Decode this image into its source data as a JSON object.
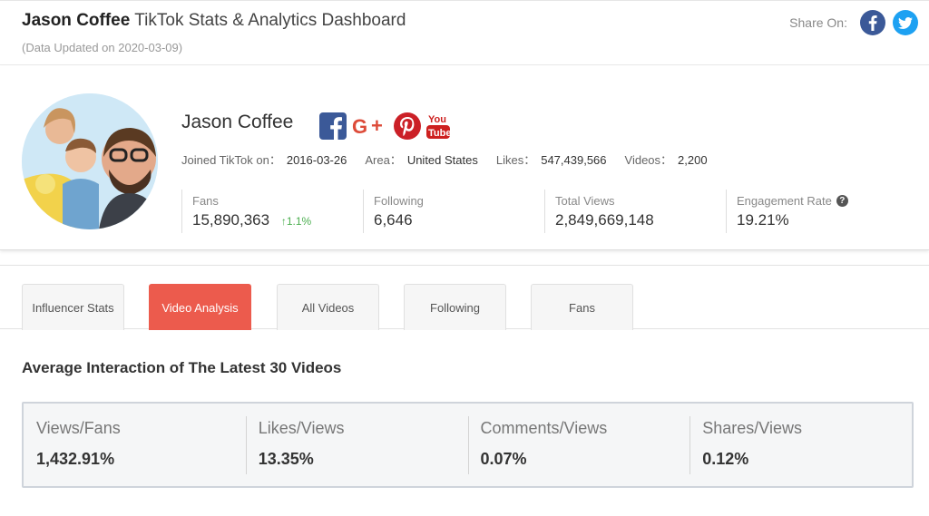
{
  "header": {
    "name": "Jason Coffee",
    "subtitle": "TikTok Stats & Analytics Dashboard",
    "updated": "(Data Updated on 2020-03-09)",
    "share_label": "Share On:",
    "share_icons": [
      "facebook-icon",
      "twitter-icon"
    ]
  },
  "profile": {
    "name": "Jason Coffee",
    "social_icons": [
      "facebook-icon",
      "google-plus-icon",
      "pinterest-icon",
      "youtube-icon"
    ],
    "meta": [
      {
        "label": "Joined TikTok on：",
        "value": "2016-03-26"
      },
      {
        "label": "Area：",
        "value": "United States"
      },
      {
        "label": "Likes：",
        "value": "547,439,566"
      },
      {
        "label": "Videos：",
        "value": "2,200"
      }
    ],
    "stats": [
      {
        "label": "Fans",
        "value": "15,890,363",
        "growth": "1.1%"
      },
      {
        "label": "Following",
        "value": "6,646"
      },
      {
        "label": "Total Views",
        "value": "2,849,669,148"
      },
      {
        "label": "Engagement Rate",
        "value": "19.21%"
      }
    ]
  },
  "tabs": [
    {
      "label": "Influencer Stats",
      "active": false
    },
    {
      "label": "Video Analysis",
      "active": true
    },
    {
      "label": "All Videos",
      "active": false
    },
    {
      "label": "Following",
      "active": false
    },
    {
      "label": "Fans",
      "active": false
    }
  ],
  "section": {
    "title": "Average Interaction of The Latest 30 Videos",
    "metrics": [
      {
        "label": "Views/Fans",
        "value": "1,432.91%"
      },
      {
        "label": "Likes/Views",
        "value": "13.35%"
      },
      {
        "label": "Comments/Views",
        "value": "0.07%"
      },
      {
        "label": "Shares/Views",
        "value": "0.12%"
      }
    ]
  },
  "colors": {
    "accent": "#ec5b4d",
    "growth": "#4caf50",
    "facebook": "#3b5998",
    "twitter": "#1da1f2",
    "pinterest": "#cb2027",
    "youtube": "#cd201f",
    "google_plus": "#dd4b39"
  }
}
